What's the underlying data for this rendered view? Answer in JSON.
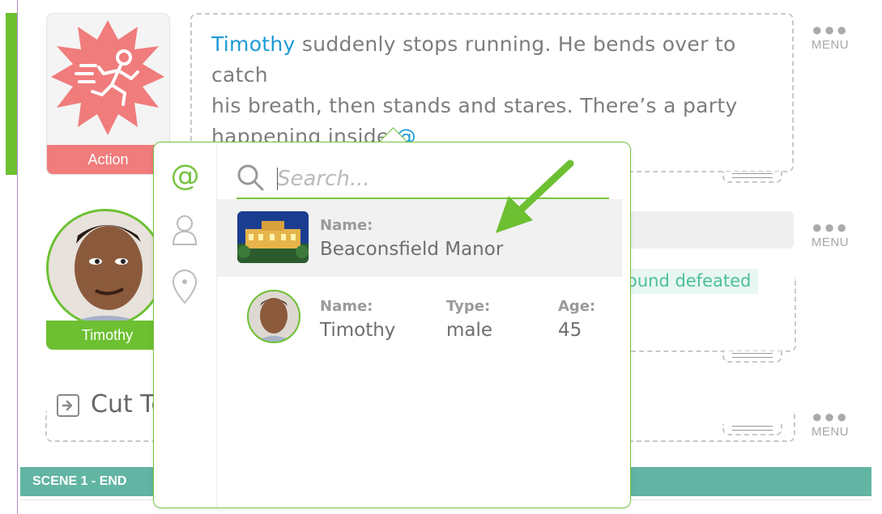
{
  "scene": {
    "action_label": "Action",
    "action_text": {
      "mention_name": "Timothy",
      "line1_rest": " suddenly stops running. He bends over to catch",
      "line2": "his breath, then stands and stares. There’s a party",
      "line3": "happening inside ",
      "at_symbol": "@"
    },
    "character_name": "Timothy",
    "dialogue_fragment": "ound defeated",
    "transition_label": "Cut To",
    "menu_label": "MENU",
    "scene_end_label": "SCENE 1 - END"
  },
  "popup": {
    "tabs": [
      {
        "name": "mention",
        "glyph": "@"
      },
      {
        "name": "character"
      },
      {
        "name": "location"
      }
    ],
    "search_placeholder": "Search...",
    "results": [
      {
        "name_label": "Name:",
        "name": "Beaconsfield Manor",
        "kind": "location"
      },
      {
        "name_label": "Name:",
        "name": "Timothy",
        "type_label": "Type:",
        "type": "male",
        "age_label": "Age:",
        "age": "45",
        "kind": "character"
      }
    ]
  },
  "colors": {
    "accent_green": "#6cc031",
    "mention_blue": "#1d9ad6",
    "action_red": "#f07c7c",
    "scene_teal": "#61b5a2",
    "arrow_green": "#6cc031"
  }
}
